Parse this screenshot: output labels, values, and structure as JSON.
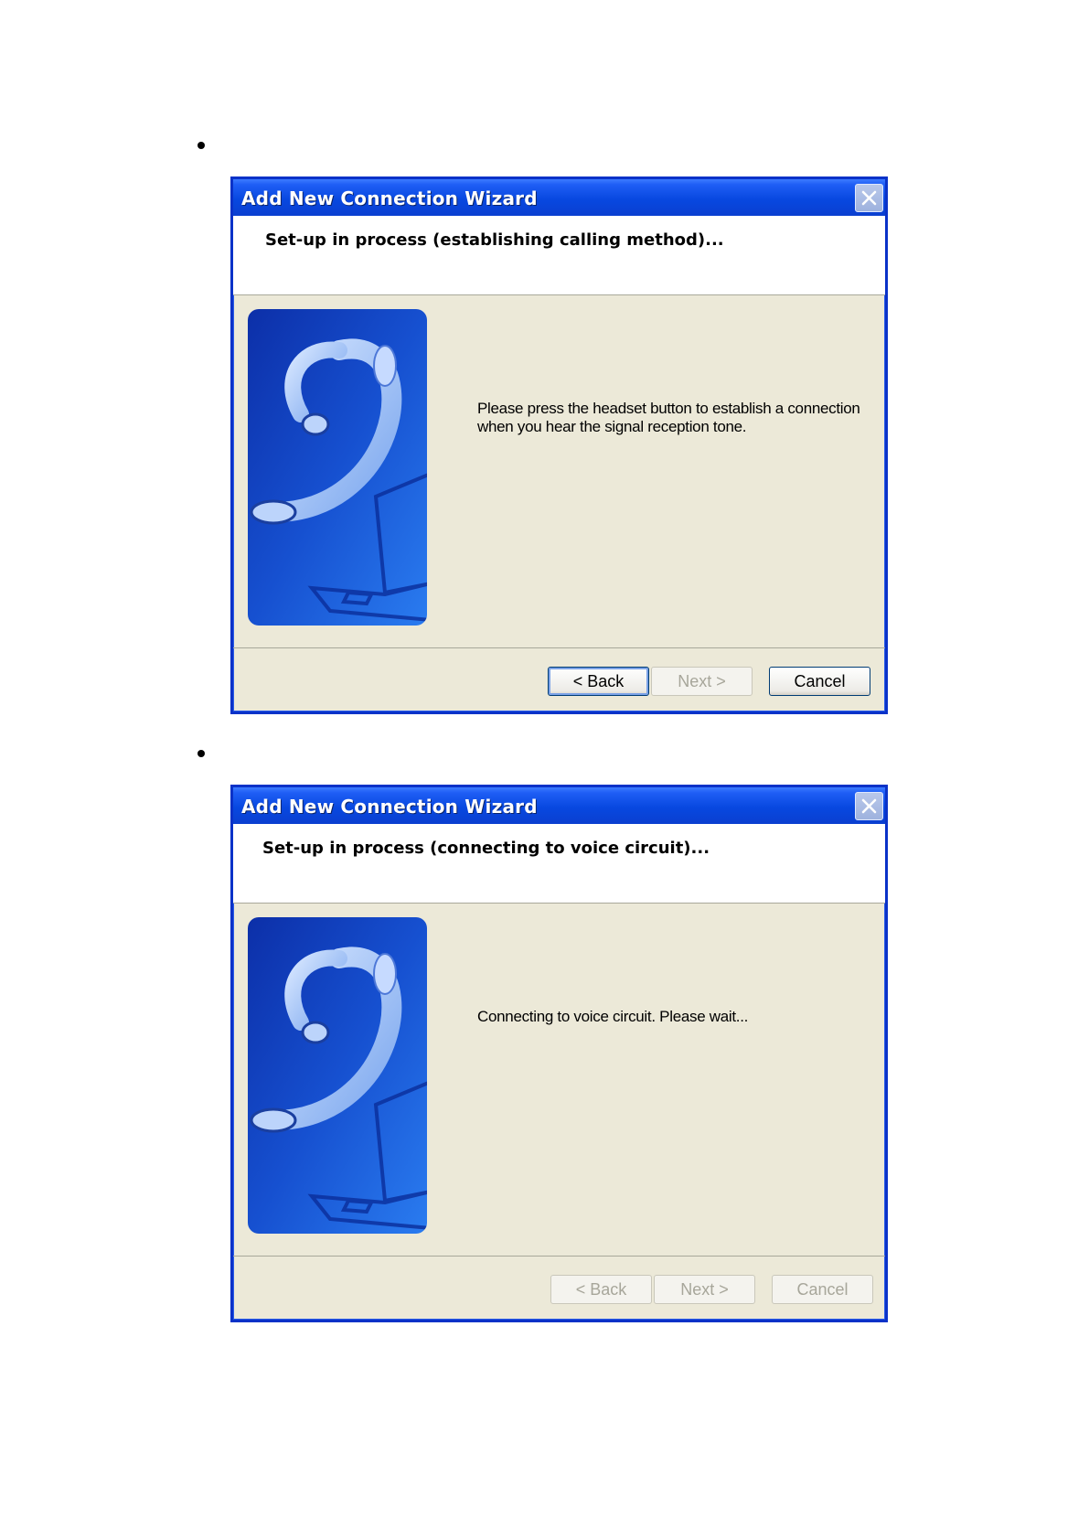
{
  "dialogs": [
    {
      "window_title": "Add New Connection Wizard",
      "header_title": "Set-up in process (establishing calling method)...",
      "message": "Please press the headset button to establish a connection when you hear the signal reception tone.",
      "buttons": {
        "back": "< Back",
        "next": "Next >",
        "cancel": "Cancel"
      },
      "enabled": {
        "back": true,
        "next": false,
        "cancel": true
      }
    },
    {
      "window_title": "Add New Connection Wizard",
      "header_title": "Set-up in process (connecting to voice circuit)...",
      "message": "Connecting to voice circuit. Please wait...",
      "buttons": {
        "back": "< Back",
        "next": "Next >",
        "cancel": "Cancel"
      },
      "enabled": {
        "back": false,
        "next": false,
        "cancel": false
      }
    }
  ],
  "colors": {
    "titlebar": "#0848e0",
    "dialog_bg": "#ece9d8",
    "art_blue": "#1450c8"
  },
  "icons": [
    "close-icon",
    "headset-illustration",
    "laptop-illustration"
  ]
}
